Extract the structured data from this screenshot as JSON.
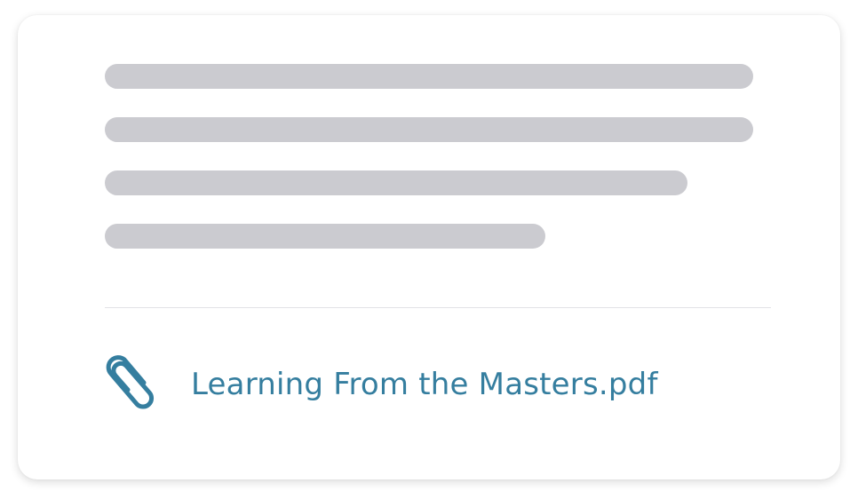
{
  "attachment": {
    "file_name": "Learning From the Masters.pdf",
    "icon": "paperclip-icon"
  },
  "colors": {
    "accent": "#357e9f",
    "placeholder_line": "#cbcbd0",
    "divider": "#e2e2e6"
  }
}
